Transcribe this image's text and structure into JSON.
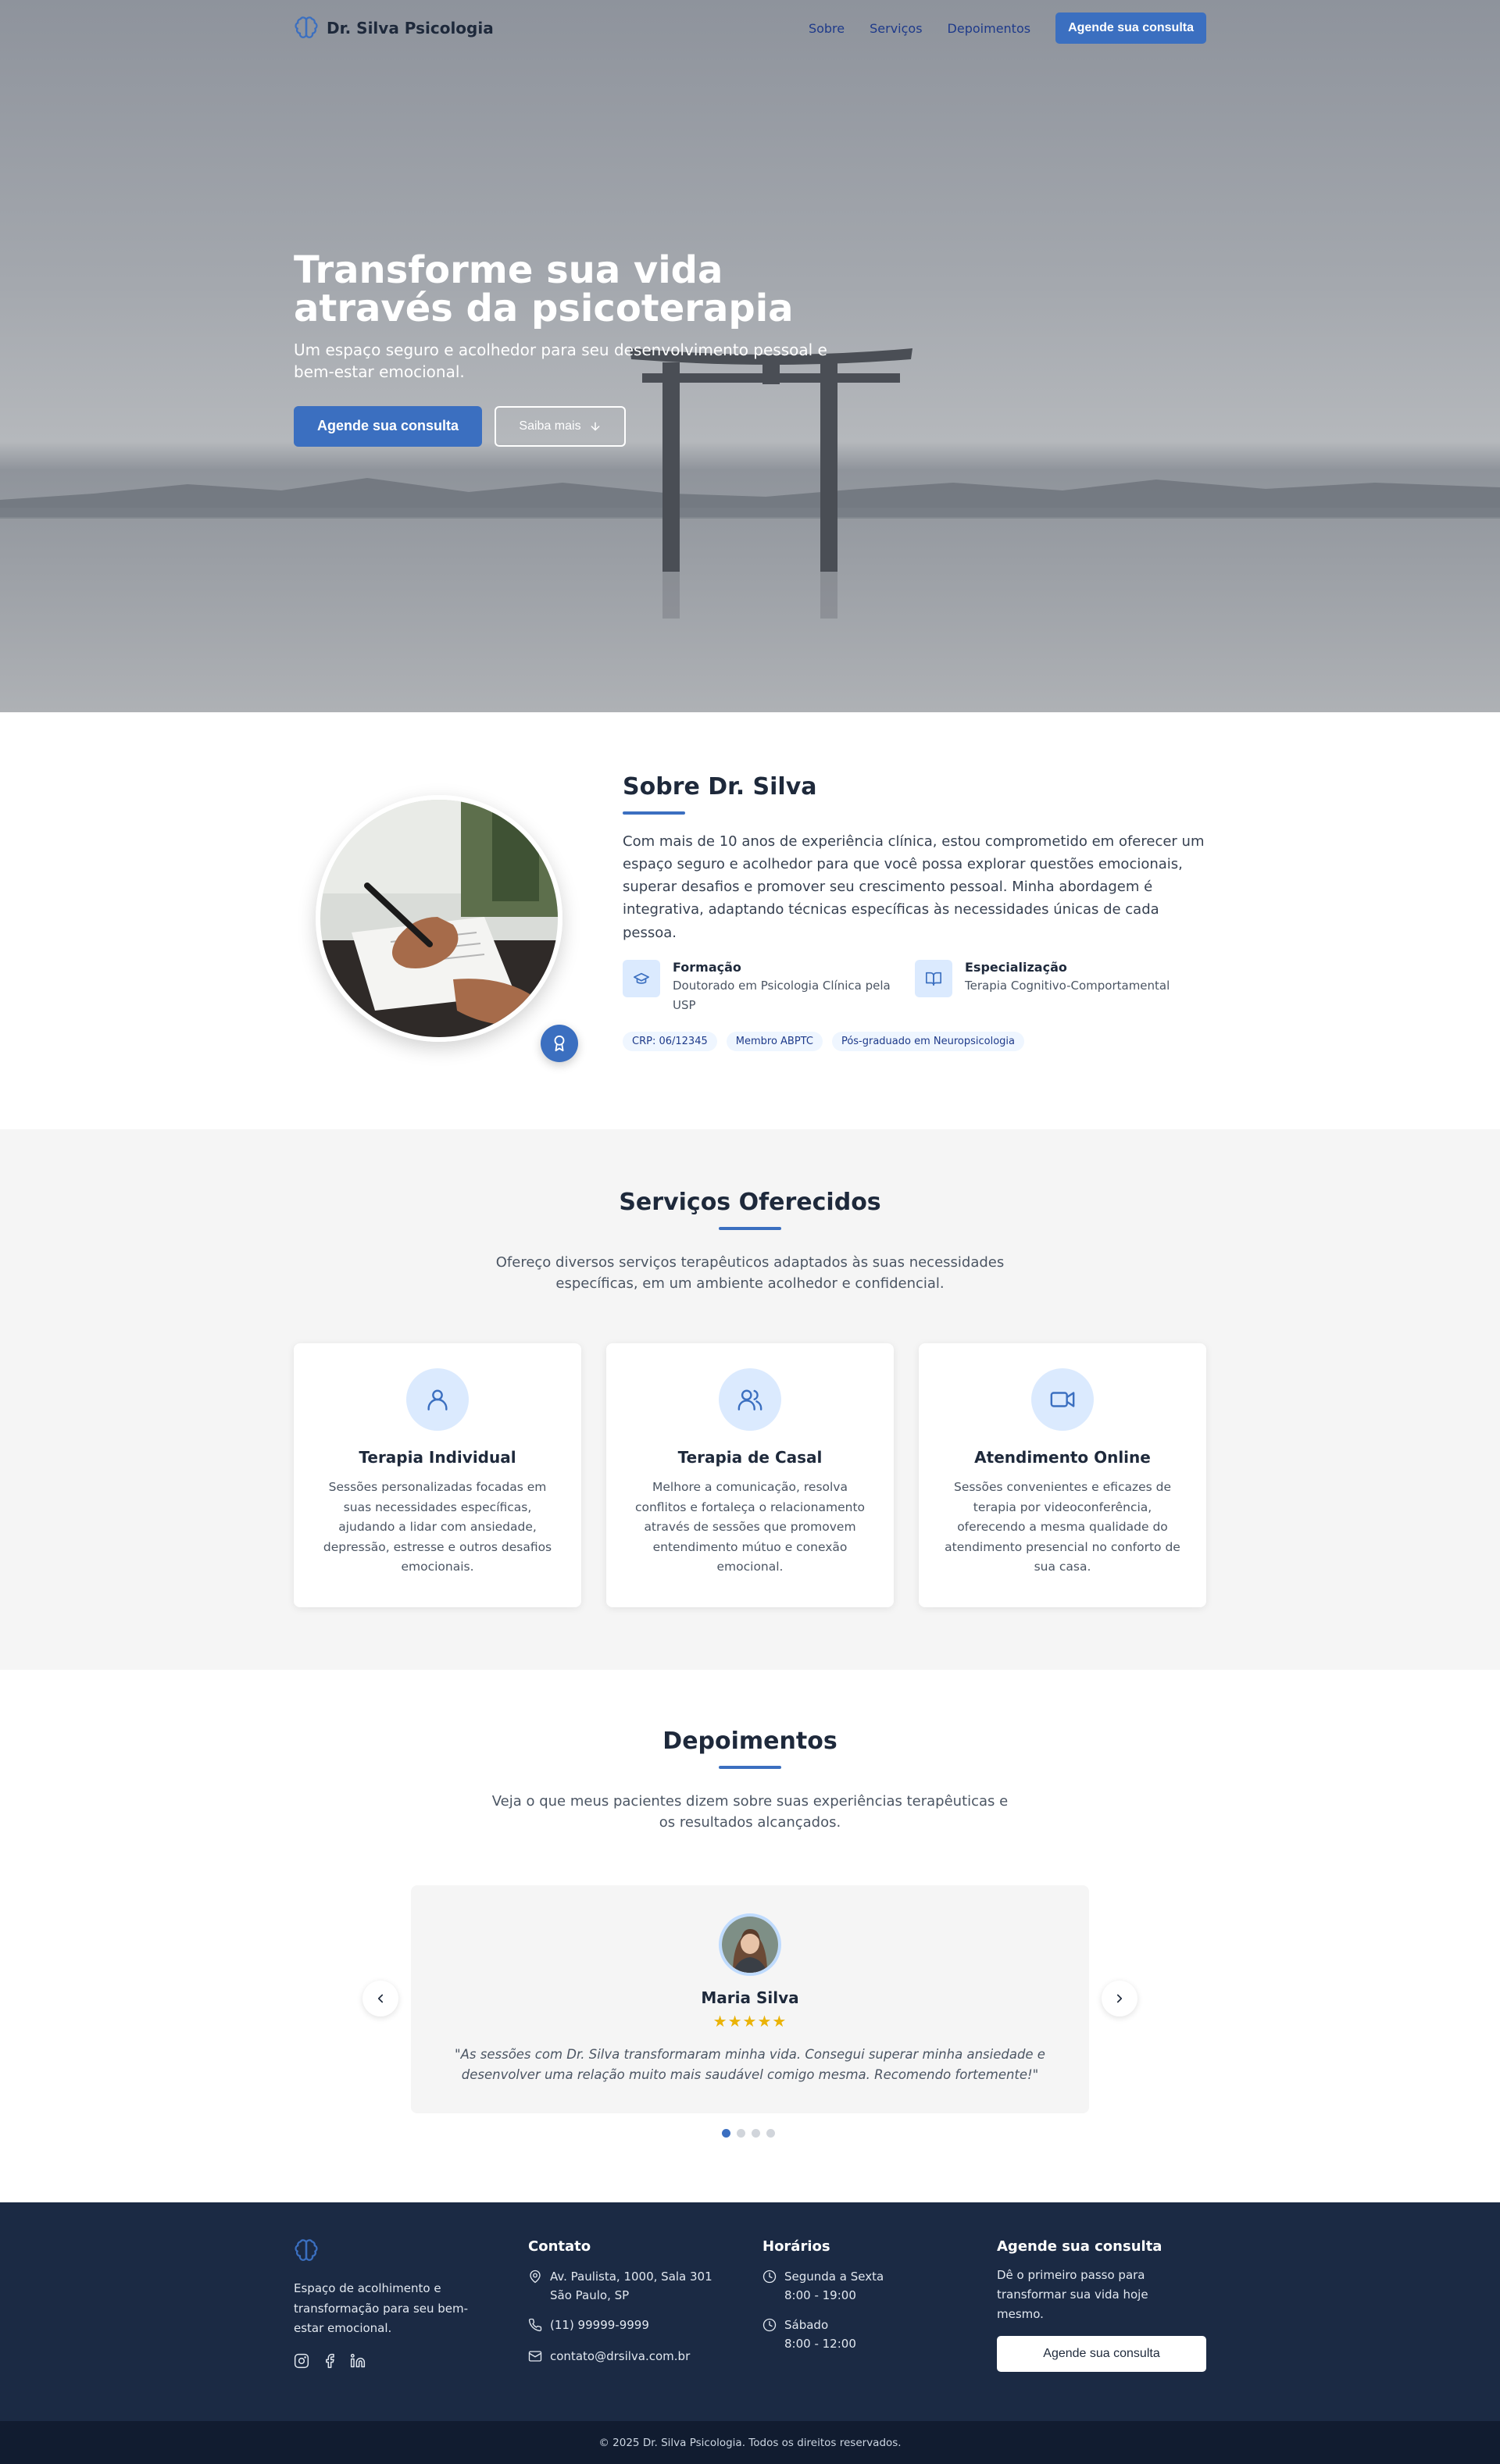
{
  "nav": {
    "brand": "Dr. Silva Psicologia",
    "links": [
      "Sobre",
      "Serviços",
      "Depoimentos"
    ],
    "cta": "Agende sua consulta"
  },
  "hero": {
    "title": "Transforme sua vida através da psicoterapia",
    "subtitle": "Um espaço seguro e acolhedor para seu desenvolvimento pessoal e bem-estar emocional.",
    "primary_cta": "Agende sua consulta",
    "secondary_cta": "Saiba mais"
  },
  "about": {
    "title": "Sobre Dr. Silva",
    "bio": "Com mais de 10 anos de experiência clínica, estou comprometido em oferecer um espaço seguro e acolhedor para que você possa explorar questões emocionais, superar desafios e promover seu crescimento pessoal. Minha abordagem é integrativa, adaptando técnicas específicas às necessidades únicas de cada pessoa.",
    "features": [
      {
        "title": "Formação",
        "desc": "Doutorado em Psicologia Clínica pela USP",
        "icon": "graduation-cap-icon"
      },
      {
        "title": "Especialização",
        "desc": "Terapia Cognitivo-Comportamental",
        "icon": "book-open-icon"
      }
    ],
    "tags": [
      "CRP: 06/12345",
      "Membro ABPTC",
      "Pós-graduado em Neuropsicologia"
    ]
  },
  "services": {
    "title": "Serviços Oferecidos",
    "lead": "Ofereço diversos serviços terapêuticos adaptados às suas necessidades específicas, em um ambiente acolhedor e confidencial.",
    "cards": [
      {
        "title": "Terapia Individual",
        "desc": "Sessões personalizadas focadas em suas necessidades específicas, ajudando a lidar com ansiedade, depressão, estresse e outros desafios emocionais.",
        "icon": "user-icon"
      },
      {
        "title": "Terapia de Casal",
        "desc": "Melhore a comunicação, resolva conflitos e fortaleça o relacionamento através de sessões que promovem entendimento mútuo e conexão emocional.",
        "icon": "users-icon"
      },
      {
        "title": "Atendimento Online",
        "desc": "Sessões convenientes e eficazes de terapia por videoconferência, oferecendo a mesma qualidade do atendimento presencial no conforto de sua casa.",
        "icon": "video-icon"
      }
    ]
  },
  "testimonials": {
    "title": "Depoimentos",
    "lead": "Veja o que meus pacientes dizem sobre suas experiências terapêuticas e os resultados alcançados.",
    "current": {
      "name": "Maria Silva",
      "stars": "★★★★★",
      "rating": 5,
      "quote": "\"As sessões com Dr. Silva transformaram minha vida. Consegui superar minha ansiedade e desenvolver uma relação muito mais saudável comigo mesma. Recomendo fortemente!\""
    },
    "slide_count": 4,
    "active_slide": 1
  },
  "footer": {
    "about": "Espaço de acolhimento e transformação para seu bem-estar emocional.",
    "contact_title": "Contato",
    "address_line1": "Av. Paulista, 1000, Sala 301",
    "address_line2": "São Paulo, SP",
    "phone": "(11) 99999-9999",
    "email": "contato@drsilva.com.br",
    "hours_title": "Horários",
    "hours": [
      {
        "days": "Segunda a Sexta",
        "time": "8:00 - 19:00"
      },
      {
        "days": "Sábado",
        "time": "8:00 - 12:00"
      }
    ],
    "cta_title": "Agende sua consulta",
    "cta_text": "Dê o primeiro passo para transformar sua vida hoje mesmo.",
    "cta_button": "Agende sua consulta",
    "copyright": "© 2025 Dr. Silva Psicologia. Todos os direitos reservados."
  },
  "colors": {
    "accent": "#3b6fc0",
    "dark": "#1b2a44",
    "light_blue": "#dbeafe",
    "star": "#eab308"
  }
}
